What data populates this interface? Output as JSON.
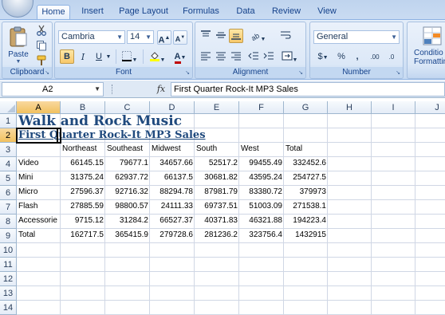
{
  "tabs": [
    "Home",
    "Insert",
    "Page Layout",
    "Formulas",
    "Data",
    "Review",
    "View"
  ],
  "active_tab": "Home",
  "ribbon": {
    "clipboard": {
      "label": "Clipboard",
      "paste": "Paste"
    },
    "font": {
      "label": "Font",
      "name": "Cambria",
      "size": "14",
      "bold": "B",
      "italic": "I",
      "underline": "U",
      "grow": "A",
      "shrink": "A",
      "font_color": "A"
    },
    "alignment": {
      "label": "Alignment"
    },
    "number": {
      "label": "Number",
      "format": "General",
      "currency": "$",
      "percent": "%",
      "comma": ",",
      "inc_decimal": ".00",
      "dec_decimal": ".0"
    },
    "styles": {
      "conditional": "Conditio",
      "formatting": "Formattin"
    }
  },
  "formula_bar": {
    "name_box": "A2",
    "fx": "fx",
    "content": "First Quarter Rock-It MP3 Sales"
  },
  "columns": [
    "A",
    "B",
    "C",
    "D",
    "E",
    "F",
    "G",
    "H",
    "I",
    "J"
  ],
  "rows": [
    "1",
    "2",
    "3",
    "4",
    "5",
    "6",
    "7",
    "8",
    "9",
    "10",
    "11",
    "12",
    "13",
    "14"
  ],
  "cells": {
    "title": "Walk and Rock Music",
    "subtitle": "First Quarter Rock-It MP3 Sales",
    "headers": [
      "Northeast",
      "Southeast",
      "Midwest",
      "South",
      "West",
      "Total"
    ],
    "data": [
      {
        "label": "Video",
        "values": [
          "66145.15",
          "79677.1",
          "34657.66",
          "52517.2",
          "99455.49",
          "332452.6"
        ]
      },
      {
        "label": "Mini",
        "values": [
          "31375.24",
          "62937.72",
          "66137.5",
          "30681.82",
          "43595.24",
          "254727.5"
        ]
      },
      {
        "label": "Micro",
        "values": [
          "27596.37",
          "92716.32",
          "88294.78",
          "87981.79",
          "83380.72",
          "379973"
        ]
      },
      {
        "label": "Flash",
        "values": [
          "27885.59",
          "98800.57",
          "24111.33",
          "69737.51",
          "51003.09",
          "271538.1"
        ]
      },
      {
        "label": "Accessorie",
        "values": [
          "9715.12",
          "31284.2",
          "66527.37",
          "40371.83",
          "46321.88",
          "194223.4"
        ]
      },
      {
        "label": "Total",
        "values": [
          "162717.5",
          "365415.9",
          "279728.6",
          "281236.2",
          "323756.4",
          "1432915"
        ]
      }
    ]
  }
}
